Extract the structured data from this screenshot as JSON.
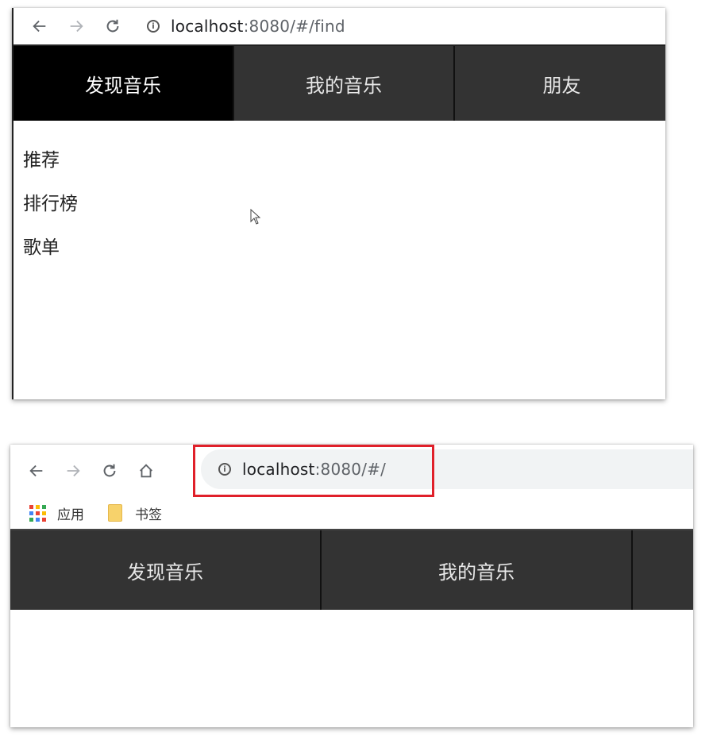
{
  "top_window": {
    "address_bar": {
      "host": "localhost",
      "path": ":8080/#/find"
    },
    "tabs": [
      {
        "label": "发现音乐",
        "active": true
      },
      {
        "label": "我的音乐",
        "active": false
      },
      {
        "label": "朋友",
        "active": false
      }
    ],
    "sub_links": [
      "推荐",
      "排行榜",
      "歌单"
    ]
  },
  "bottom_window": {
    "address_bar": {
      "host": "localhost",
      "path": ":8080/#/"
    },
    "bookmarks": {
      "apps": "应用",
      "folder": "书签"
    },
    "tabs": [
      {
        "label": "发现音乐"
      },
      {
        "label": "我的音乐"
      },
      {
        "label": ""
      }
    ]
  },
  "colors": {
    "tabbar_bg": "#333333",
    "active_tab_bg": "#000000",
    "highlight_border": "#e0202a",
    "apps_grid": [
      "#ea4335",
      "#fbbc05",
      "#34a853",
      "#4285f4",
      "#ea4335",
      "#fbbc05",
      "#34a853",
      "#4285f4",
      "#ea4335"
    ]
  }
}
